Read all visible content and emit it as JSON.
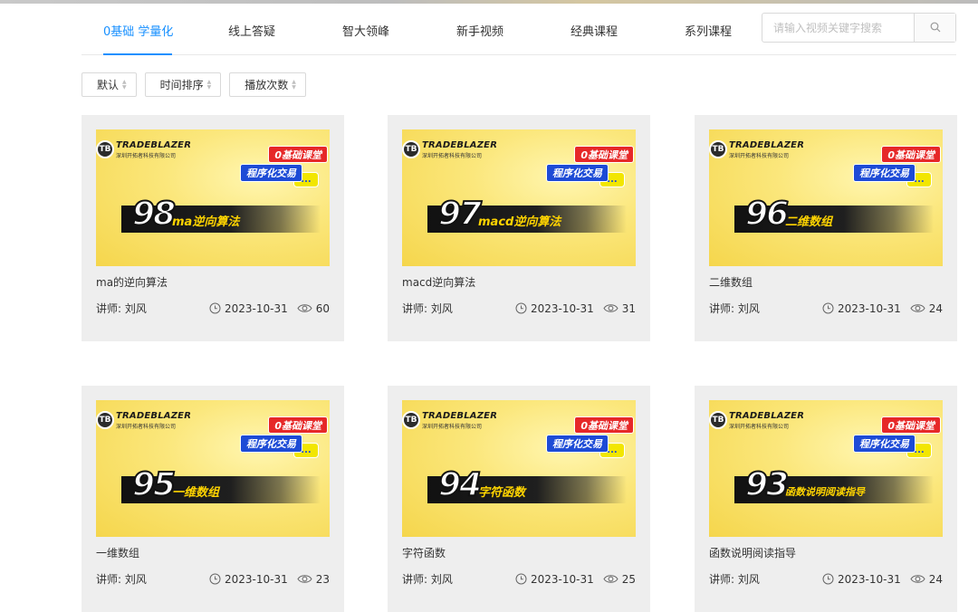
{
  "tabs": [
    {
      "label": "0基础 学量化",
      "active": true
    },
    {
      "label": "线上答疑",
      "active": false
    },
    {
      "label": "智大领峰",
      "active": false
    },
    {
      "label": "新手视频",
      "active": false
    },
    {
      "label": "经典课程",
      "active": false
    },
    {
      "label": "系列课程",
      "active": false
    }
  ],
  "search": {
    "placeholder": "请输入视频关键字搜索",
    "value": "",
    "icon": "search-icon"
  },
  "sorts": [
    {
      "label": "默认",
      "icon": "sort-icon"
    },
    {
      "label": "时间排序",
      "icon": "sort-icon"
    },
    {
      "label": "播放次数",
      "icon": "sort-icon"
    }
  ],
  "colors": {
    "accent": "#1890ff",
    "badge_red": "#e62828",
    "badge_blue": "#1d4bd6",
    "card_bg": "#eeeeee"
  },
  "thumb_common": {
    "brand": "TRADEBLAZER",
    "logo_mark": "TB",
    "company": "深圳开拓者科技有限公司",
    "badge_red": "0基础课堂",
    "badge_blue": "程序化交易",
    "bubble": "..."
  },
  "videos": [
    {
      "number": "98",
      "thumb_title": "ma逆向算法",
      "title": "ma的逆向算法",
      "teacher": "讲师: 刘风",
      "date": "2023-10-31",
      "views": "60"
    },
    {
      "number": "97",
      "thumb_title": "macd逆向算法",
      "title": "macd逆向算法",
      "teacher": "讲师: 刘风",
      "date": "2023-10-31",
      "views": "31"
    },
    {
      "number": "96",
      "thumb_title": "二维数组",
      "title": "二维数组",
      "teacher": "讲师: 刘风",
      "date": "2023-10-31",
      "views": "24"
    },
    {
      "number": "95",
      "thumb_title": "一维数组",
      "title": "一维数组",
      "teacher": "讲师: 刘风",
      "date": "2023-10-31",
      "views": "23"
    },
    {
      "number": "94",
      "thumb_title": "字符函数",
      "title": "字符函数",
      "teacher": "讲师: 刘风",
      "date": "2023-10-31",
      "views": "25"
    },
    {
      "number": "93",
      "thumb_title": "函数说明阅读指导",
      "title": "函数说明阅读指导",
      "teacher": "讲师: 刘风",
      "date": "2023-10-31",
      "views": "24"
    }
  ]
}
